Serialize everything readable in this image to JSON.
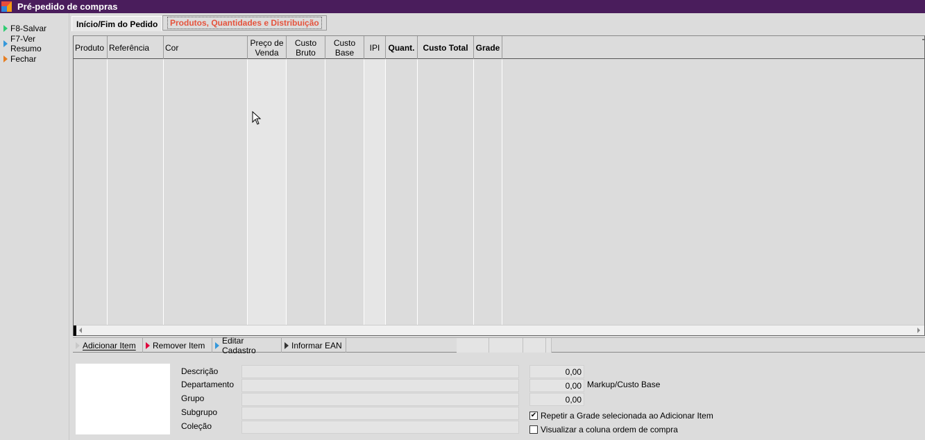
{
  "window": {
    "title": "Pré-pedido de compras"
  },
  "sidebar": {
    "items": [
      {
        "label": "F8-Salvar",
        "icon": "green-triangle-icon"
      },
      {
        "label": "F7-Ver Resumo",
        "icon": "blue-triangle-icon"
      },
      {
        "label": "Fechar",
        "icon": "orange-triangle-icon"
      }
    ]
  },
  "tabs": [
    {
      "label": "Início/Fim do Pedido",
      "active": false
    },
    {
      "label": "Produtos, Quantidades e Distribuição",
      "active": true
    }
  ],
  "grid": {
    "columns": [
      {
        "line1": "Produto",
        "line2": ""
      },
      {
        "line1": "Referência",
        "line2": ""
      },
      {
        "line1": "Cor",
        "line2": ""
      },
      {
        "line1": "Preço de",
        "line2": "Venda"
      },
      {
        "line1": "Custo",
        "line2": "Bruto"
      },
      {
        "line1": "Custo",
        "line2": "Base"
      },
      {
        "line1": "IPI",
        "line2": ""
      },
      {
        "line1": "Quant.",
        "line2": ""
      },
      {
        "line1": "Custo Total",
        "line2": ""
      },
      {
        "line1": "Grade",
        "line2": ""
      }
    ],
    "rows": []
  },
  "toolbar": {
    "add_item": "Adicionar Item",
    "remove_item": "Remover Item",
    "edit_cadastro": "Editar Cadastro",
    "informar_ean": "Informar EAN"
  },
  "details": {
    "labels": {
      "descricao": "Descrição",
      "departamento": "Departamento",
      "grupo": "Grupo",
      "subgrupo": "Subgrupo",
      "colecao": "Coleção"
    },
    "values": {
      "descricao": "",
      "departamento": "",
      "grupo": "",
      "subgrupo": "",
      "colecao": ""
    },
    "numbers": [
      "0,00",
      "0,00",
      "0,00"
    ],
    "markup_label": "Markup/Custo Base",
    "checkboxes": [
      {
        "label": "Repetir a Grade selecionada ao Adicionar Item",
        "checked": true
      },
      {
        "label": "Visualizar a coluna ordem de compra",
        "checked": false
      }
    ]
  },
  "colors": {
    "titlebar": "#4a1d5c",
    "active_tab_text": "#e5533d"
  }
}
